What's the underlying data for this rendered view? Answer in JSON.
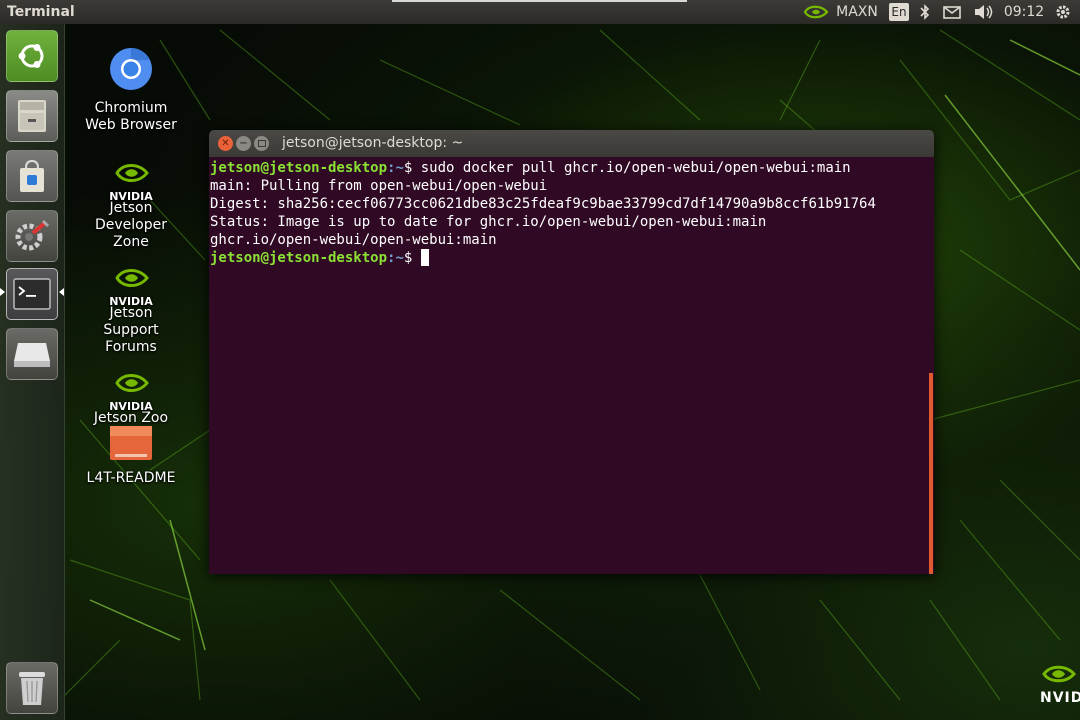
{
  "top_panel": {
    "app_title": "Terminal",
    "power_mode": "MAXN",
    "keyboard_layout": "En",
    "clock": "09:12",
    "icons": [
      "nvidia-icon",
      "bluetooth-icon",
      "mail-icon",
      "volume-icon",
      "settings-gear-icon"
    ]
  },
  "launcher": {
    "items": [
      {
        "name": "ubuntu-dash",
        "icon": "ubuntu-logo-icon"
      },
      {
        "name": "files",
        "icon": "file-cabinet-icon"
      },
      {
        "name": "software-center",
        "icon": "shopping-bag-icon"
      },
      {
        "name": "system-settings",
        "icon": "settings-wrench-icon"
      },
      {
        "name": "terminal",
        "icon": "terminal-icon",
        "active": true
      },
      {
        "name": "drive",
        "icon": "drive-icon"
      },
      {
        "name": "trash",
        "icon": "trash-icon"
      }
    ]
  },
  "desktop": {
    "chromium_label": "Chromium Web Browser",
    "devzone_label": "Jetson Developer Zone",
    "forums_label": "Jetson Support Forums",
    "zoo_label": "Jetson Zoo",
    "readme_label": "L4T-README",
    "nvidia_text": "NVIDIA"
  },
  "terminal": {
    "title": "jetson@jetson-desktop: ~",
    "prompt_user": "jetson@jetson-desktop",
    "prompt_path": ":~",
    "prompt_symbol": "$",
    "command": " sudo docker pull ghcr.io/open-webui/open-webui:main",
    "output": [
      "main: Pulling from open-webui/open-webui",
      "Digest: sha256:cecf06773cc0621dbe83c25fdeaf9c9bae33799cd7df14790a9b8ccf61b91764",
      "Status: Image is up to date for ghcr.io/open-webui/open-webui:main",
      "ghcr.io/open-webui/open-webui:main"
    ]
  },
  "wallpaper_corner_text": "NVID",
  "colors": {
    "terminal_bg": "#300a24",
    "prompt_user": "#8ae234",
    "prompt_path": "#729fcf",
    "close_button": "#e9623a",
    "scrollbar": "#e05a30"
  }
}
